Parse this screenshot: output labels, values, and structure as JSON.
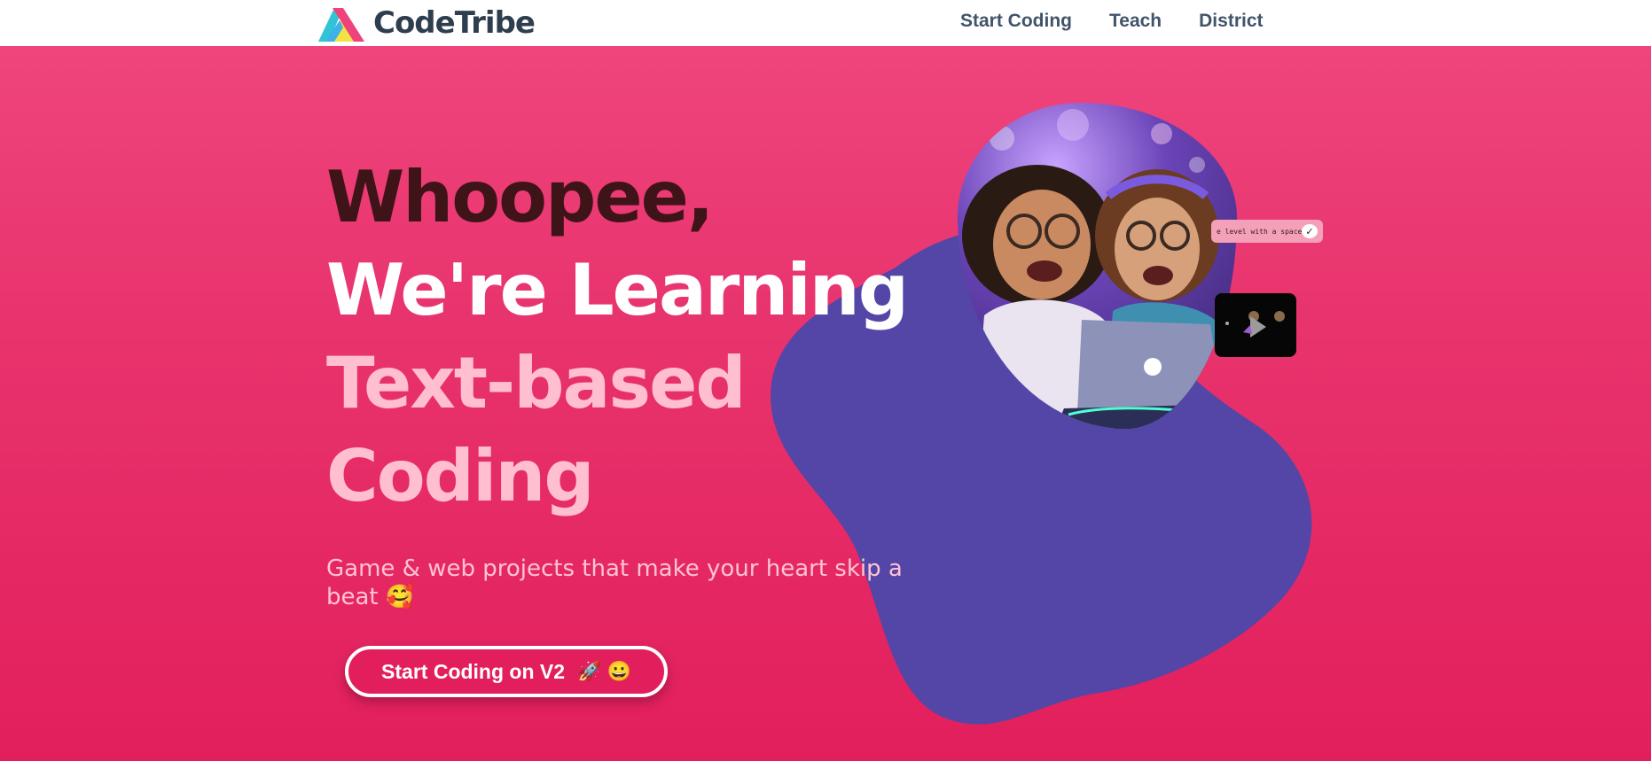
{
  "brand": {
    "name": "CodeTribe"
  },
  "nav": {
    "items": [
      {
        "label": "Start Coding"
      },
      {
        "label": "Teach"
      },
      {
        "label": "District"
      }
    ]
  },
  "hero": {
    "headline": {
      "line1": "Whoopee,",
      "line2": "We're Learning",
      "line3": "Text-based",
      "line4": "Coding"
    },
    "subtitle": "Game & web projects that make your heart skip a beat 🥰",
    "cta": {
      "label": "Start Coding on V2",
      "emoji": "🚀 😀"
    },
    "code_chip": {
      "text": "e level with a space"
    }
  },
  "colors": {
    "brand_pink": "#e21f5c",
    "headline_dark": "#3f1418",
    "headline_light": "#ffbfd0",
    "blob_purple": "#5346a7",
    "nav_text": "#41546a"
  },
  "icons": [
    "codetribe-logo-icon",
    "check-icon",
    "play-icon"
  ]
}
